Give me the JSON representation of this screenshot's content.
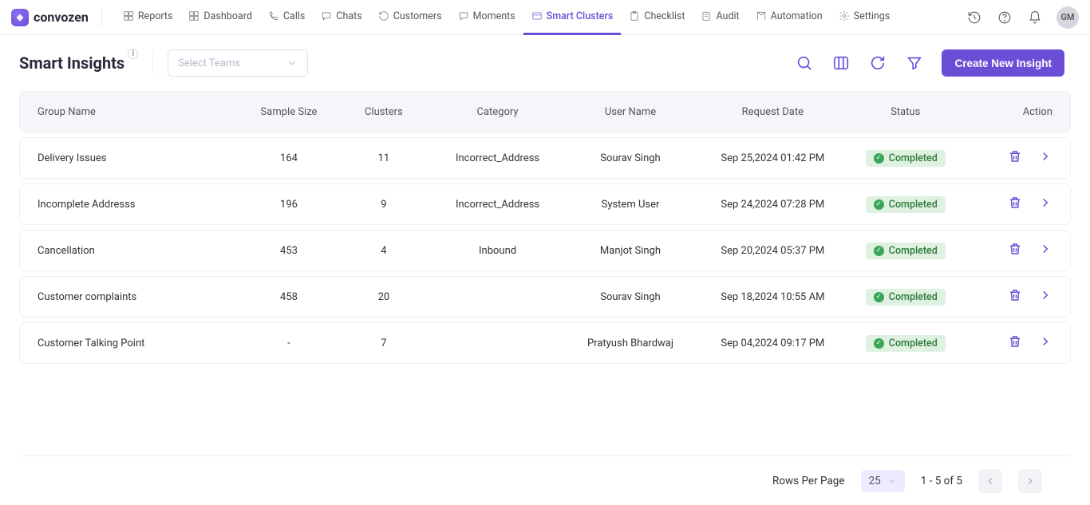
{
  "nav": [
    {
      "label": "Reports"
    },
    {
      "label": "Dashboard"
    },
    {
      "label": "Calls"
    },
    {
      "label": "Chats"
    },
    {
      "label": "Customers"
    },
    {
      "label": "Moments"
    },
    {
      "label": "Smart Clusters",
      "active": true
    },
    {
      "label": "Checklist"
    },
    {
      "label": "Audit"
    },
    {
      "label": "Automation"
    },
    {
      "label": "Settings"
    }
  ],
  "brand": "convozen",
  "avatar": "GM",
  "page": {
    "title": "Smart Insights",
    "team_placeholder": "Select Teams",
    "create_label": "Create New Insight"
  },
  "columns": {
    "group_name": "Group Name",
    "sample_size": "Sample Size",
    "clusters": "Clusters",
    "category": "Category",
    "user_name": "User Name",
    "request_date": "Request Date",
    "status": "Status",
    "action": "Action"
  },
  "rows": [
    {
      "group": "Delivery Issues",
      "sample": "164",
      "clusters": "11",
      "category": "Incorrect_Address",
      "user": "Sourav Singh",
      "date": "Sep 25,2024 01:42 PM",
      "status": "Completed"
    },
    {
      "group": "Incomplete Addresss",
      "sample": "196",
      "clusters": "9",
      "category": "Incorrect_Address",
      "user": "System User",
      "date": "Sep 24,2024 07:28 PM",
      "status": "Completed"
    },
    {
      "group": "Cancellation",
      "sample": "453",
      "clusters": "4",
      "category": "Inbound",
      "user": "Manjot Singh",
      "date": "Sep 20,2024 05:37 PM",
      "status": "Completed"
    },
    {
      "group": "Customer complaints",
      "sample": "458",
      "clusters": "20",
      "category": "",
      "user": "Sourav Singh",
      "date": "Sep 18,2024 10:55 AM",
      "status": "Completed"
    },
    {
      "group": "Customer Talking Point",
      "sample": "-",
      "clusters": "7",
      "category": "",
      "user": "Pratyush Bhardwaj",
      "date": "Sep 04,2024 09:17 PM",
      "status": "Completed"
    }
  ],
  "footer": {
    "rows_label": "Rows Per Page",
    "rows_value": "25",
    "range": "1 - 5 of 5"
  }
}
